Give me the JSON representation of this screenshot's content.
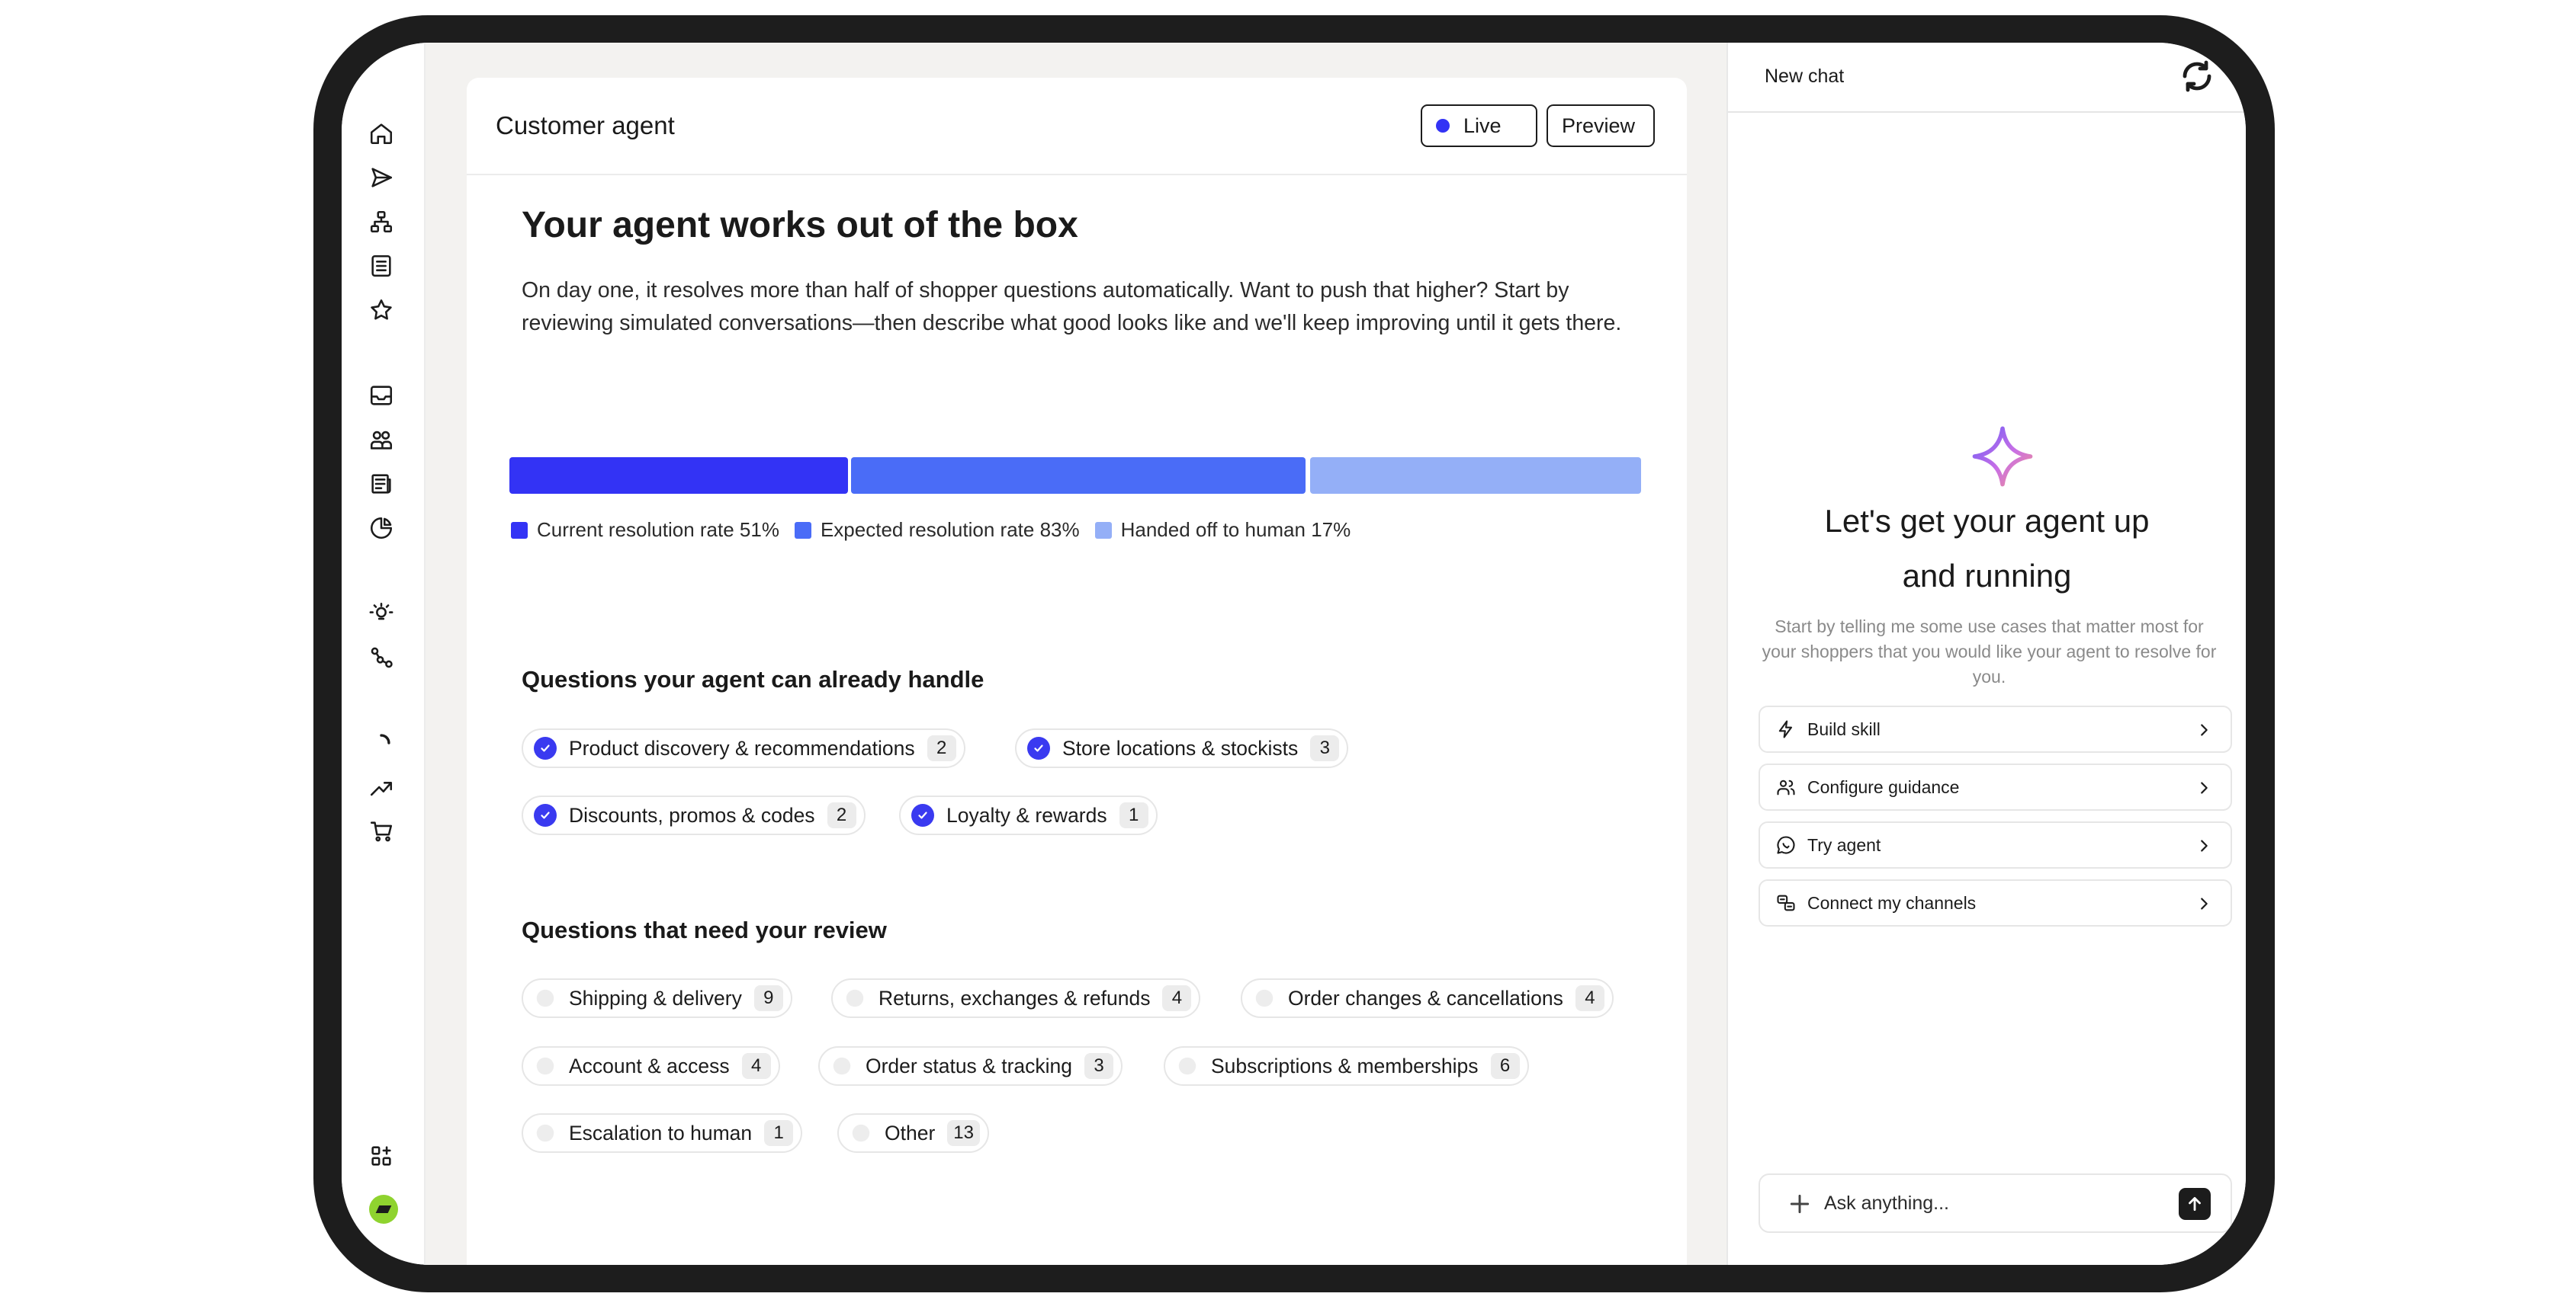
{
  "card": {
    "title": "Customer agent",
    "live_label": "Live",
    "preview_label": "Preview",
    "heading": "Your agent works out of the box",
    "intro": "On day one, it resolves more than half of shopper questions automatically. Want to push that higher? Start by reviewing simulated conversations—then describe what good looks like and we'll keep improving until it gets there."
  },
  "resolution": {
    "segments": [
      {
        "label": "Current resolution rate 51%",
        "percent": 51,
        "color": "#3333f5"
      },
      {
        "label": "Expected resolution rate 83%",
        "percent": 83,
        "color": "#4a6cf7"
      },
      {
        "label": "Handed off to human 17%",
        "percent": 17,
        "color": "#94aff7"
      }
    ]
  },
  "handled": {
    "title": "Questions your agent can already handle",
    "chips": [
      {
        "label": "Product discovery & recommendations",
        "count": "2"
      },
      {
        "label": "Store locations & stockists",
        "count": "3"
      },
      {
        "label": "Discounts, promos & codes",
        "count": "2"
      },
      {
        "label": "Loyalty & rewards",
        "count": "1"
      }
    ]
  },
  "review": {
    "title": "Questions that need your review",
    "chips": [
      {
        "label": "Shipping & delivery",
        "count": "9"
      },
      {
        "label": "Returns, exchanges & refunds",
        "count": "4"
      },
      {
        "label": "Order changes & cancellations",
        "count": "4"
      },
      {
        "label": "Account & access",
        "count": "4"
      },
      {
        "label": "Order status & tracking",
        "count": "3"
      },
      {
        "label": "Subscriptions & memberships",
        "count": "6"
      },
      {
        "label": "Escalation to human",
        "count": "1"
      },
      {
        "label": "Other",
        "count": "13"
      }
    ]
  },
  "chat": {
    "title": "New chat",
    "welcome_line1": "Let's get your agent up",
    "welcome_line2": "and running",
    "welcome_sub": "Start by telling me some use cases that matter most for your shoppers that you would like your agent to resolve for you.",
    "actions": [
      {
        "label": "Build skill",
        "icon": "lightning-icon"
      },
      {
        "label": "Configure guidance",
        "icon": "users-icon"
      },
      {
        "label": "Try agent",
        "icon": "chat-bubble-icon"
      },
      {
        "label": "Connect my channels",
        "icon": "channels-icon"
      }
    ],
    "input_placeholder": "Ask anything..."
  },
  "colors": {
    "accent": "#3333f5",
    "brand_avatar": "#8fd32f"
  }
}
